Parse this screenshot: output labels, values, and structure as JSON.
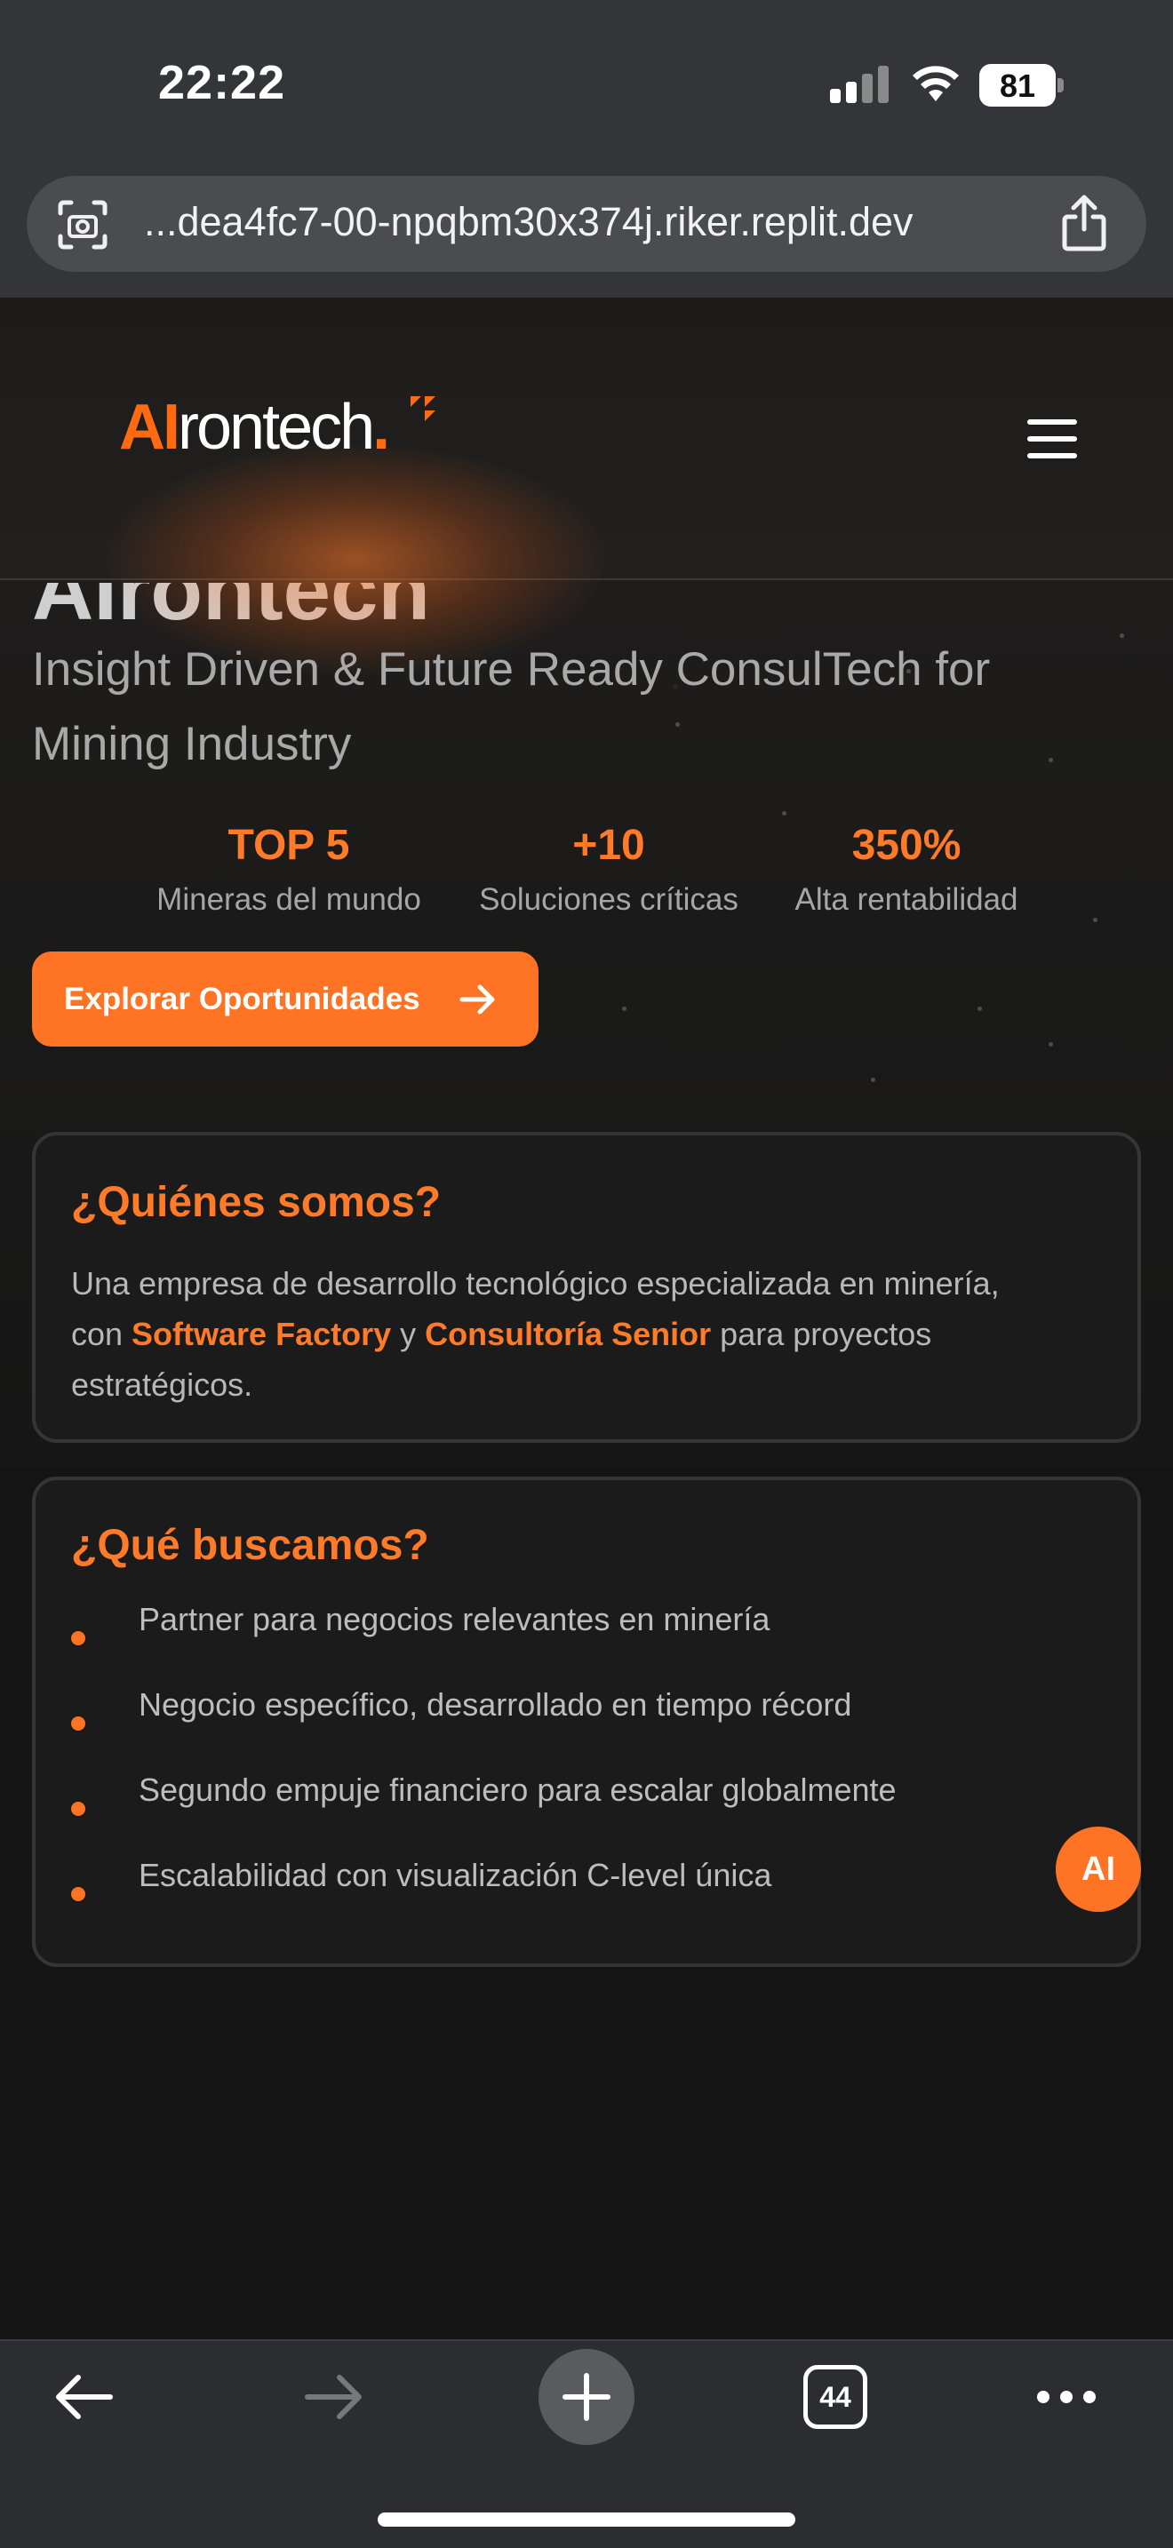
{
  "status_bar": {
    "time": "22:22",
    "battery": "81"
  },
  "browser": {
    "url": "...dea4fc7-00-npqbm30x374j.riker.replit.dev",
    "tabs_count": "44"
  },
  "header": {
    "logo_ai": "AI",
    "logo_rest": "rontech"
  },
  "hero": {
    "cut_title": "AIrontech",
    "subtitle": "Insight Driven & Future Ready ConsulTech for Mining Industry",
    "stats": [
      {
        "value": "TOP 5",
        "label": "Mineras del mundo"
      },
      {
        "value": "+10",
        "label": "Soluciones críticas"
      },
      {
        "value": "350%",
        "label": "Alta rentabilidad"
      }
    ],
    "cta_label": "Explorar Oportunidades"
  },
  "about": {
    "title": "¿Quiénes somos?",
    "text_1": "Una empresa de desarrollo tecnológico especializada en minería,",
    "text_2a": "con ",
    "text_2b": "Software Factory",
    "text_2c": " y ",
    "text_2d": "Consultoría Senior",
    "text_2e": " para proyectos",
    "text_3": "estratégicos."
  },
  "seeking": {
    "title": "¿Qué buscamos?",
    "items": [
      "Partner para negocios relevantes en minería",
      "Negocio específico, desarrollado en tiempo récord",
      "Segundo empuje financiero para escalar globalmente",
      "Escalabilidad con visualización C-level única"
    ]
  },
  "ai_fab": "AI",
  "colors": {
    "accent": "#ff7324",
    "background": "#141414",
    "card_border": "#353535"
  }
}
